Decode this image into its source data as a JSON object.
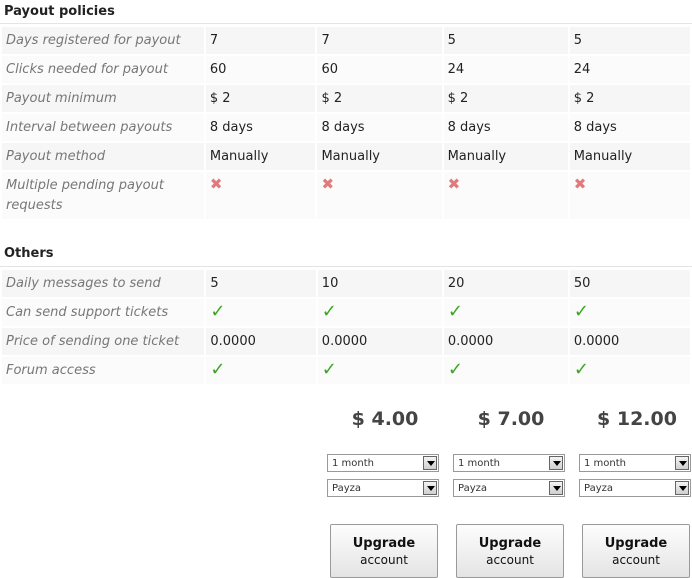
{
  "payout": {
    "title": "Payout policies",
    "rows": [
      {
        "label": "Days registered for payout",
        "values": [
          "7",
          "7",
          "5",
          "5"
        ]
      },
      {
        "label": "Clicks needed for payout",
        "values": [
          "60",
          "60",
          "24",
          "24"
        ]
      },
      {
        "label": "Payout minimum",
        "values": [
          "$ 2",
          "$ 2",
          "$ 2",
          "$ 2"
        ]
      },
      {
        "label": "Interval between payouts",
        "values": [
          "8 days",
          "8 days",
          "8 days",
          "8 days"
        ]
      },
      {
        "label": "Payout method",
        "values": [
          "Manually",
          "Manually",
          "Manually",
          "Manually"
        ]
      },
      {
        "label": "Multiple pending payout requests",
        "values": [
          "no",
          "no",
          "no",
          "no"
        ]
      }
    ]
  },
  "others": {
    "title": "Others",
    "rows": [
      {
        "label": "Daily messages to send",
        "values": [
          "5",
          "10",
          "20",
          "50"
        ]
      },
      {
        "label": "Can send support tickets",
        "values": [
          "yes",
          "yes",
          "yes",
          "yes"
        ]
      },
      {
        "label": "Price of sending one ticket",
        "values": [
          "0.0000",
          "0.0000",
          "0.0000",
          "0.0000"
        ]
      },
      {
        "label": "Forum access",
        "values": [
          "yes",
          "yes",
          "yes",
          "yes"
        ]
      }
    ]
  },
  "plans": [
    {
      "price": "$ 4.00",
      "period": "1 month",
      "method": "Payza",
      "button_line1": "Upgrade",
      "button_line2": "account"
    },
    {
      "price": "$ 7.00",
      "period": "1 month",
      "method": "Payza",
      "button_line1": "Upgrade",
      "button_line2": "account"
    },
    {
      "price": "$ 12.00",
      "period": "1 month",
      "method": "Payza",
      "button_line1": "Upgrade",
      "button_line2": "account"
    }
  ],
  "icons": {
    "cross": "cross-icon",
    "check": "check-icon"
  },
  "colors": {
    "check": "#3aa620",
    "cross": "#e07b7b"
  }
}
